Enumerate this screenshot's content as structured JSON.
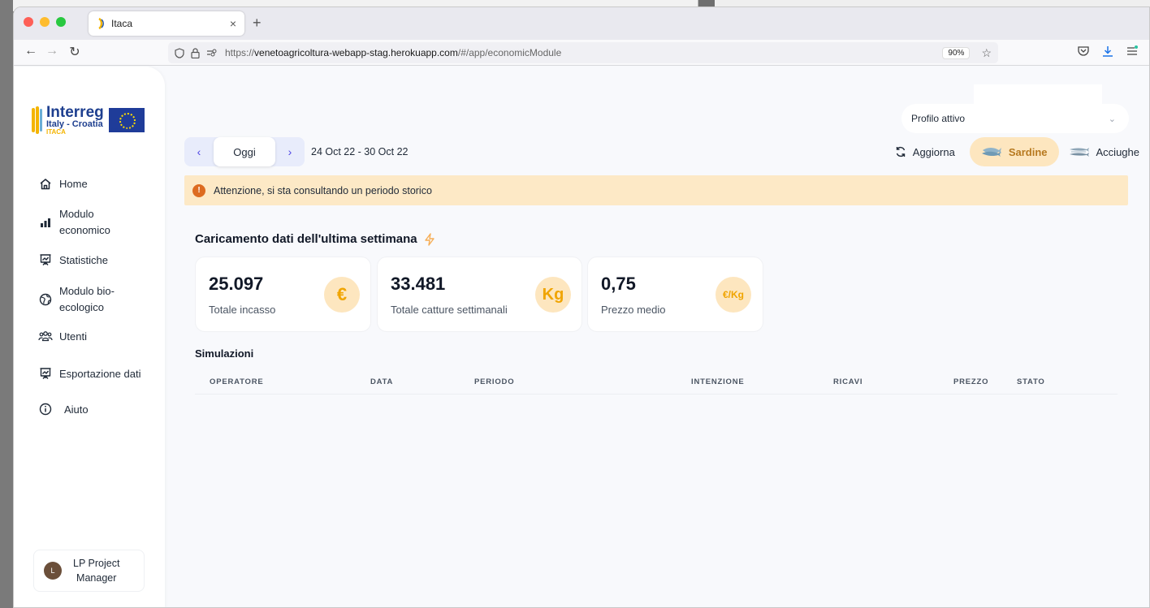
{
  "browser": {
    "tab_title": "Itaca",
    "tab_close": "×",
    "new_tab": "+",
    "url_prefix": "https://",
    "url_host": "venetoagricoltura-webapp-stag.herokuapp.com",
    "url_path": "/#/app/economicModule",
    "zoom": "90%"
  },
  "sidebar": {
    "logo": {
      "brand": "Interreg",
      "subtitle": "Italy - Croatia",
      "project": "ITACA",
      "eu_label": "EUROPEAN UNION"
    },
    "items": [
      {
        "label": "Home",
        "icon": "home-icon"
      },
      {
        "label": "Modulo economico",
        "line1": "Modulo",
        "line2": "economico",
        "icon": "bar-chart-icon"
      },
      {
        "label": "Statistiche",
        "icon": "presentation-chart-icon"
      },
      {
        "label": "Modulo bio-ecologico",
        "line1": "Modulo bio-",
        "line2": "ecologico",
        "icon": "globe-icon"
      },
      {
        "label": "Utenti",
        "icon": "users-icon"
      },
      {
        "label": "Esportazione dati",
        "icon": "presentation-chart-icon"
      },
      {
        "label": "Aiuto",
        "icon": "info-icon"
      }
    ],
    "user": {
      "initial": "L",
      "name_line1": "LP Project",
      "name_line2": "Manager"
    }
  },
  "header": {
    "profile_label": "Profilo attivo",
    "today_button": "Oggi",
    "date_range": "24 Oct 22 - 30 Oct 22",
    "refresh_label": "Aggiorna",
    "species": [
      {
        "label": "Sardine",
        "active": true
      },
      {
        "label": "Acciughe",
        "active": false
      }
    ]
  },
  "alert": {
    "icon_text": "!",
    "message": "Attenzione, si sta consultando un periodo storico"
  },
  "summary": {
    "title": "Caricamento dati dell'ultima settimana",
    "cards": [
      {
        "value": "25.097",
        "label": "Totale incasso",
        "icon_text": "€"
      },
      {
        "value": "33.481",
        "label": "Totale catture settimanali",
        "icon_text": "Kg"
      },
      {
        "value": "0,75",
        "label": "Prezzo medio",
        "icon_text": "€/Kg"
      }
    ]
  },
  "simulations": {
    "title": "Simulazioni",
    "columns": [
      "OPERATORE",
      "DATA",
      "PERIODO",
      "INTENZIONE",
      "RICAVI",
      "PREZZO",
      "STATO"
    ],
    "rows": []
  },
  "colors": {
    "accent": "#4f46e5",
    "warning_bg": "#fde9c6",
    "warning_icon": "#dd6b20",
    "badge_bg": "#fde6bf",
    "badge_text": "#f0a400"
  }
}
